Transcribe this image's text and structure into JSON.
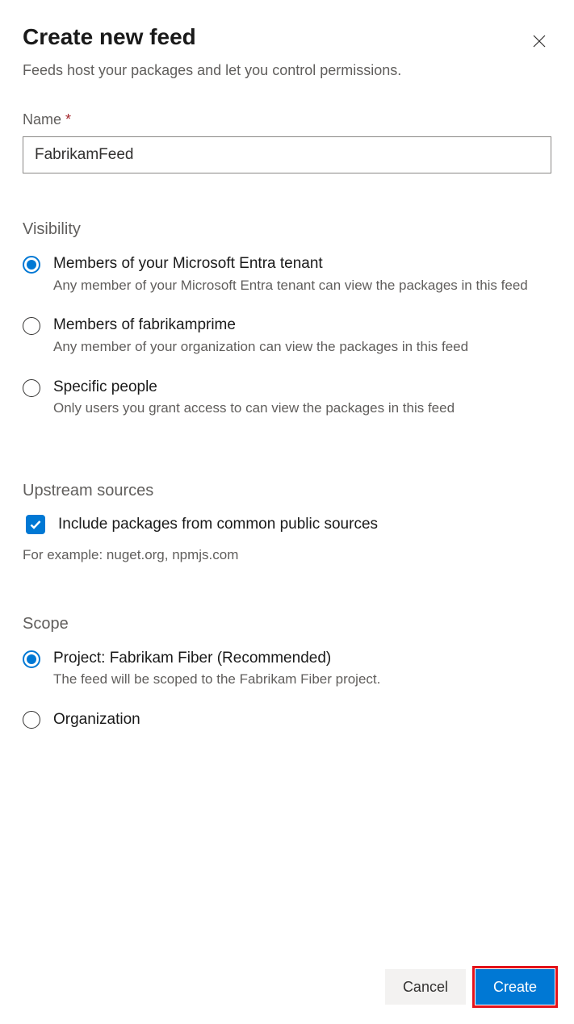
{
  "dialog": {
    "title": "Create new feed",
    "subtitle": "Feeds host your packages and let you control permissions."
  },
  "name": {
    "label": "Name",
    "required_mark": " *",
    "value": "FabrikamFeed"
  },
  "visibility": {
    "heading": "Visibility",
    "options": [
      {
        "title": "Members of your Microsoft Entra tenant",
        "desc": "Any member of your Microsoft Entra tenant can view the packages in this feed",
        "selected": true
      },
      {
        "title": "Members of fabrikamprime",
        "desc": "Any member of your organization can view the packages in this feed",
        "selected": false
      },
      {
        "title": "Specific people",
        "desc": "Only users you grant access to can view the packages in this feed",
        "selected": false
      }
    ]
  },
  "upstream": {
    "heading": "Upstream sources",
    "checkbox_label": "Include packages from common public sources",
    "checked": true,
    "example": "For example: nuget.org, npmjs.com"
  },
  "scope": {
    "heading": "Scope",
    "options": [
      {
        "title": "Project: Fabrikam Fiber (Recommended)",
        "desc": "The feed will be scoped to the Fabrikam Fiber project.",
        "selected": true
      },
      {
        "title": "Organization",
        "desc": "",
        "selected": false
      }
    ]
  },
  "buttons": {
    "cancel": "Cancel",
    "create": "Create"
  }
}
